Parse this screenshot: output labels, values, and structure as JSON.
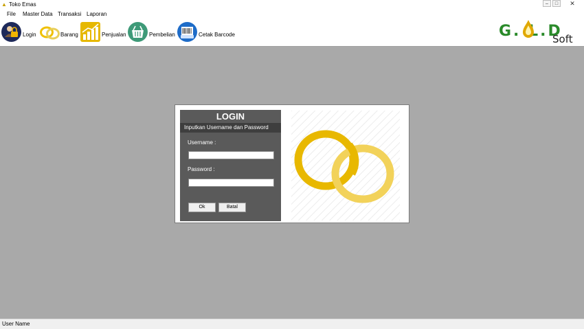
{
  "window": {
    "title": "Toko Emas",
    "app_icon": "gold-icon",
    "controls": [
      "minimize-icon",
      "maximize-icon",
      "close-icon"
    ]
  },
  "menu": {
    "items": [
      {
        "label": "File"
      },
      {
        "label": "Master Data"
      },
      {
        "label": "Transaksi"
      },
      {
        "label": "Laporan"
      }
    ]
  },
  "toolbar": {
    "buttons": [
      {
        "label": "Login",
        "icon": "lock-user-icon"
      },
      {
        "label": "Barang",
        "icon": "rings-icon"
      },
      {
        "label": "Penjualan",
        "icon": "chart-icon"
      },
      {
        "label": "Pembelian",
        "icon": "basket-icon"
      },
      {
        "label": "Cetak Barcode",
        "icon": "barcode-printer-icon"
      }
    ]
  },
  "logo": {
    "text": "G.  L.D",
    "sub": "Soft",
    "color": "#2a8a2a"
  },
  "login": {
    "title": "LOGIN",
    "subtitle": "Inputkan Username dan Password",
    "username_label": "Username :",
    "username_value": "",
    "password_label": "Password :",
    "password_value": "",
    "ok_label": "Ok",
    "cancel_label": "Batal"
  },
  "status": {
    "text": "User Name"
  },
  "colors": {
    "workspace": "#a9a9a9",
    "panel": "#5a5a5a",
    "gold": "#f0c000"
  }
}
